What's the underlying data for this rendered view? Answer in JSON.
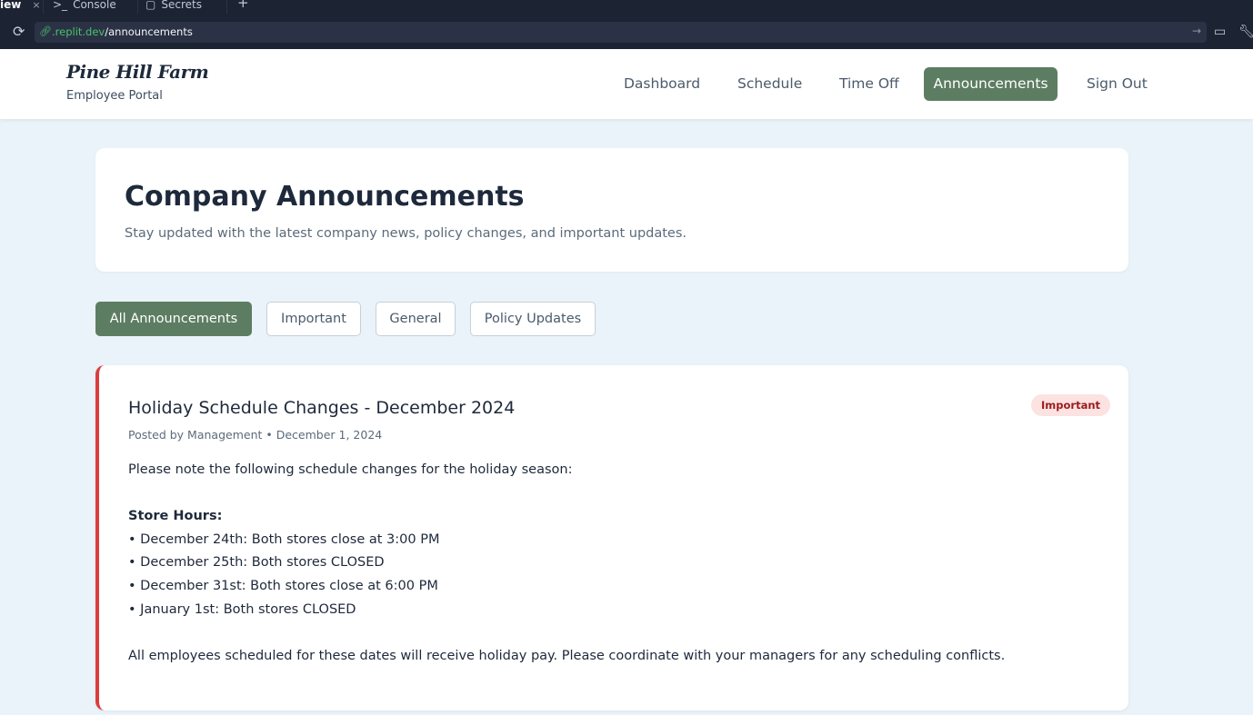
{
  "browser": {
    "tabs": [
      {
        "label": "iew",
        "close": "×"
      },
      {
        "icon": "terminal-icon",
        "label": "Console"
      },
      {
        "icon": "lock-icon",
        "label": "Secrets"
      }
    ],
    "new_tab": "+",
    "url_host": ".replit.dev",
    "url_path": "/announcements"
  },
  "header": {
    "brand": "Pine Hill Farm",
    "subtitle": "Employee Portal",
    "nav": [
      "Dashboard",
      "Schedule",
      "Time Off",
      "Announcements",
      "Sign Out"
    ],
    "active_nav": "Announcements",
    "accent_color": "#5d7d62"
  },
  "hero": {
    "title": "Company Announcements",
    "description": "Stay updated with the latest company news, policy changes, and important updates."
  },
  "filters": [
    "All Announcements",
    "Important",
    "General",
    "Policy Updates"
  ],
  "active_filter": "All Announcements",
  "announcement": {
    "title": "Holiday Schedule Changes - December 2024",
    "badge": "Important",
    "badge_color": "#dc3c3c",
    "meta": "Posted by Management • December 1, 2024",
    "intro": "Please note the following schedule changes for the holiday season:",
    "section_heading": "Store Hours:",
    "items": [
      "• December 24th: Both stores close at 3:00 PM",
      "• December 25th: Both stores CLOSED",
      "• December 31st: Both stores close at 6:00 PM",
      "• January 1st: Both stores CLOSED"
    ],
    "closing": "All employees scheduled for these dates will receive holiday pay. Please coordinate with your managers for any scheduling conflicts."
  }
}
